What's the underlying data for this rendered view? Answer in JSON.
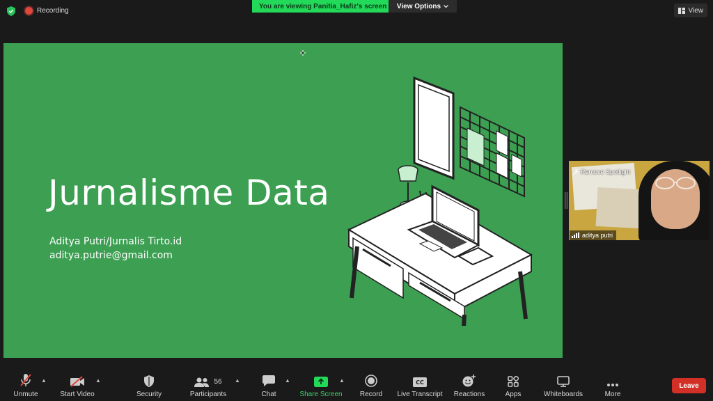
{
  "topbar": {
    "recording_label": "Recording",
    "viewing_banner": "You are viewing Panitia_Hafiz's screen",
    "view_options_label": "View Options",
    "view_label": "View"
  },
  "slide": {
    "title": "Jurnalisme Data",
    "author": "Aditya Putri/Jurnalis Tirto.id",
    "email": "aditya.putrie@gmail.com",
    "background": "#3c9f52"
  },
  "video": {
    "remove_spotlight_label": "Remove Spotlight",
    "participant_name": "aditya putri"
  },
  "toolbar": {
    "unmute": "Unmute",
    "start_video": "Start Video",
    "security": "Security",
    "participants": "Participants",
    "participants_count": "56",
    "chat": "Chat",
    "share_screen": "Share Screen",
    "record": "Record",
    "live_transcript": "Live Transcript",
    "reactions": "Reactions",
    "apps": "Apps",
    "whiteboards": "Whiteboards",
    "more": "More",
    "leave": "Leave",
    "icons": [
      "mic-muted-icon",
      "video-off-icon",
      "shield-icon",
      "participants-icon",
      "chat-icon",
      "share-screen-icon",
      "record-icon",
      "cc-icon",
      "reactions-icon",
      "apps-icon",
      "whiteboard-icon",
      "more-icon"
    ]
  },
  "colors": {
    "share_green": "#23d95a",
    "leave_red": "#d22f27",
    "muted_red": "#e0463a"
  }
}
